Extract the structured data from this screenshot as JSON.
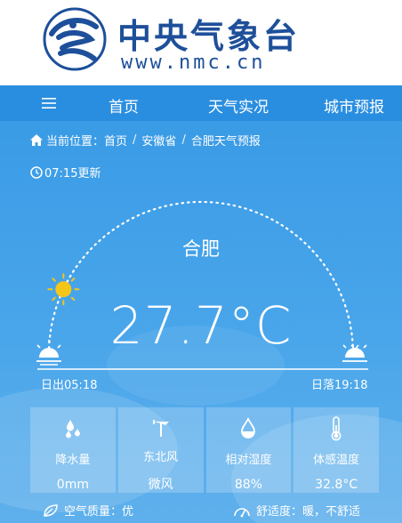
{
  "header": {
    "title": "中央气象台",
    "url": "www.nmc.cn"
  },
  "nav": {
    "items": [
      {
        "label": "首页"
      },
      {
        "label": "天气实况"
      },
      {
        "label": "城市预报"
      }
    ]
  },
  "breadcrumb": {
    "prefix": "当前位置：",
    "items": [
      "首页",
      "安徽省",
      "合肥天气预报"
    ]
  },
  "update_time": "07:15更新",
  "city": "合肥",
  "temperature": "27.7°C",
  "sunrise": "日出05:18",
  "sunset": "日落19:18",
  "sun_progress": 0.14,
  "cards": [
    {
      "icon": "raindrops-icon",
      "label": "降水量",
      "value": "0mm"
    },
    {
      "icon": "wind-vane-icon",
      "label": "东北风",
      "value": "微风"
    },
    {
      "icon": "humidity-drop-icon",
      "label": "相对湿度",
      "value": "88%"
    },
    {
      "icon": "thermometer-icon",
      "label": "体感温度",
      "value": "32.8°C"
    }
  ],
  "bottom": {
    "air_quality": "空气质量：优",
    "comfort": "舒适度：暖，不舒适"
  },
  "colors": {
    "brand": "#1e4f9a",
    "nav_bg": "#2a8ee0",
    "sun": "#f5c518"
  }
}
